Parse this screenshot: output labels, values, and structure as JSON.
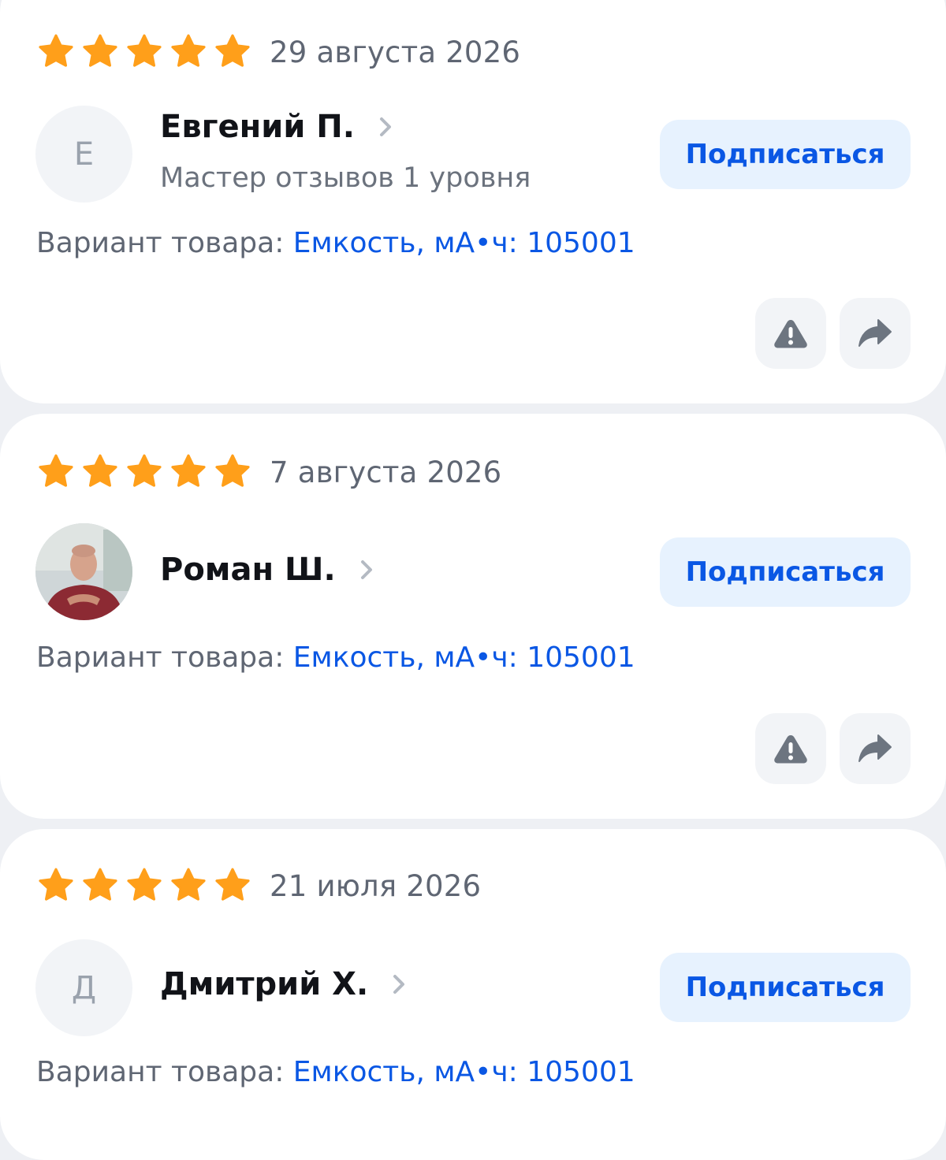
{
  "reviews": [
    {
      "rating": 5,
      "date": "29 августа 2026",
      "avatar_letter": "Е",
      "name": "Евгений П.",
      "subtitle": "Мастер отзывов 1 уровня",
      "subscribe_label": "Подписаться",
      "variant_label": "Вариант товара:",
      "variant_value": "Емкость, мА•ч: 105001"
    },
    {
      "rating": 5,
      "date": "7 августа 2026",
      "avatar_letter": "",
      "name": "Роман Ш.",
      "subtitle": "",
      "subscribe_label": "Подписаться",
      "variant_label": "Вариант товара:",
      "variant_value": "Емкость, мА•ч: 105001"
    },
    {
      "rating": 5,
      "date": "21 июля 2026",
      "avatar_letter": "Д",
      "name": "Дмитрий Х.",
      "subtitle": "",
      "subscribe_label": "Подписаться",
      "variant_label": "Вариант товара:",
      "variant_value": "Емкость, мА•ч: 105001"
    }
  ],
  "icons": {
    "star": "star-icon",
    "chevron": "chevron-right-icon",
    "report": "warning-icon",
    "share": "share-arrow-icon"
  },
  "colors": {
    "star": "#ff9f1a",
    "accent": "#0a57e4",
    "button_bg": "#e7f2fe",
    "page_bg": "#eef0f4"
  }
}
